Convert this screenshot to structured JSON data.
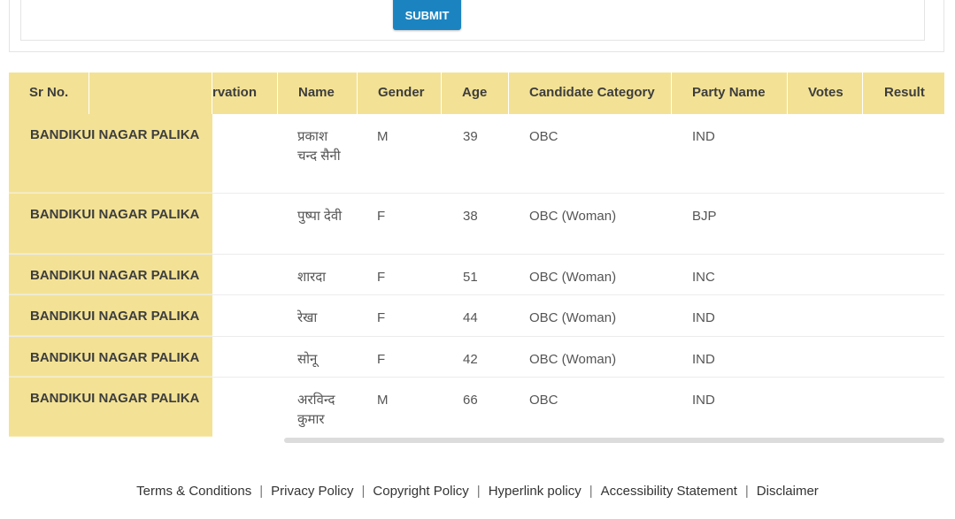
{
  "form": {
    "submit_label": "SUBMIT"
  },
  "table": {
    "headers": {
      "sr_no": "Sr No.",
      "reservation": "rvation",
      "name": "Name",
      "gender": "Gender",
      "age": "Age",
      "category": "Candidate Category",
      "party": "Party Name",
      "votes": "Votes",
      "result": "Result"
    },
    "rows": [
      {
        "body": "BANDIKUI NAGAR PALIKA",
        "name": "प्रकाश चन्द सैनी",
        "gender": "M",
        "age": "39",
        "category": "OBC",
        "party": "IND",
        "votes": "",
        "result": ""
      },
      {
        "body": "BANDIKUI NAGAR PALIKA",
        "name": "पुष्पा देवी",
        "gender": "F",
        "age": "38",
        "category": "OBC (Woman)",
        "party": "BJP",
        "votes": "",
        "result": ""
      },
      {
        "body": "BANDIKUI NAGAR PALIKA",
        "name": "शारदा",
        "gender": "F",
        "age": "51",
        "category": "OBC (Woman)",
        "party": "INC",
        "votes": "",
        "result": ""
      },
      {
        "body": "BANDIKUI NAGAR PALIKA",
        "name": "रेखा",
        "gender": "F",
        "age": "44",
        "category": "OBC (Woman)",
        "party": "IND",
        "votes": "",
        "result": ""
      },
      {
        "body": "BANDIKUI NAGAR PALIKA",
        "name": "सोनू",
        "gender": "F",
        "age": "42",
        "category": "OBC (Woman)",
        "party": "IND",
        "votes": "",
        "result": ""
      },
      {
        "body": "BANDIKUI NAGAR PALIKA",
        "name": "अरविन्द कुमार",
        "gender": "M",
        "age": "66",
        "category": "OBC",
        "party": "IND",
        "votes": "",
        "result": ""
      }
    ]
  },
  "footer": {
    "links": [
      "Terms & Conditions",
      "Privacy Policy",
      "Copyright Policy",
      "Hyperlink policy",
      "Accessibility Statement",
      "Disclaimer"
    ],
    "separator": "|"
  }
}
